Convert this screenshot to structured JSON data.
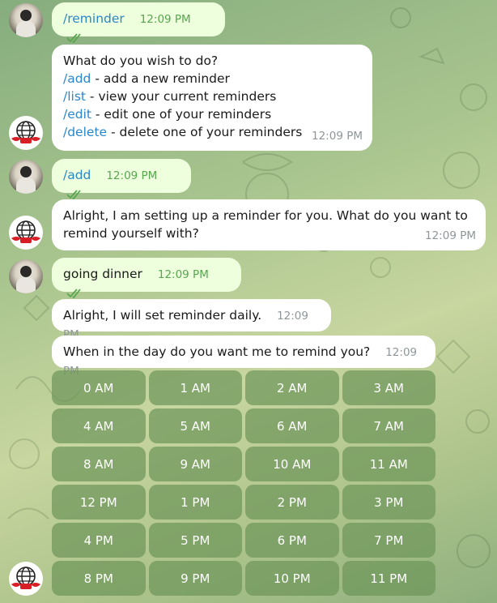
{
  "messages": [
    {
      "from": "user",
      "text": "/reminder",
      "time": "12:09 PM"
    },
    {
      "from": "bot",
      "lines": [
        {
          "cmd": "",
          "text": "What do you wish to do?"
        },
        {
          "cmd": "/add",
          "text": " - add a new reminder"
        },
        {
          "cmd": "/list",
          "text": " - view your current reminders"
        },
        {
          "cmd": "/edit",
          "text": " - edit one of your reminders"
        },
        {
          "cmd": "/delete",
          "text": " - delete one of your reminders"
        }
      ],
      "time": "12:09 PM"
    },
    {
      "from": "user",
      "text": "/add",
      "time": "12:09 PM"
    },
    {
      "from": "bot",
      "line1": "Alright, I am setting up a reminder for you. What do you want to",
      "line2": "remind yourself with?",
      "time": "12:09 PM"
    },
    {
      "from": "user",
      "text": "going dinner",
      "time": "12:09 PM"
    },
    {
      "from": "bot",
      "text": "Alright, I will set reminder daily.",
      "time": "12:09 PM"
    },
    {
      "from": "bot",
      "text": "When in the day do you want me to remind you?",
      "time": "12:09 PM"
    }
  ],
  "keyboard": [
    [
      "0 AM",
      "1 AM",
      "2 AM",
      "3 AM"
    ],
    [
      "4 AM",
      "5 AM",
      "6 AM",
      "7 AM"
    ],
    [
      "8 AM",
      "9 AM",
      "10 AM",
      "11 AM"
    ],
    [
      "12 PM",
      "1 PM",
      "2 PM",
      "3 PM"
    ],
    [
      "4 PM",
      "5 PM",
      "6 PM",
      "7 PM"
    ],
    [
      "8 PM",
      "9 PM",
      "10 PM",
      "11 PM"
    ]
  ],
  "icons": {
    "read_ticks": "double-check-icon",
    "bot_avatar": "globe-icon",
    "user_avatar": "user-photo"
  },
  "colors": {
    "outgoing_bubble": "#eeffde",
    "incoming_bubble": "#ffffff",
    "command_link": "#2a87c9",
    "keyboard_button": "#6e965a"
  }
}
